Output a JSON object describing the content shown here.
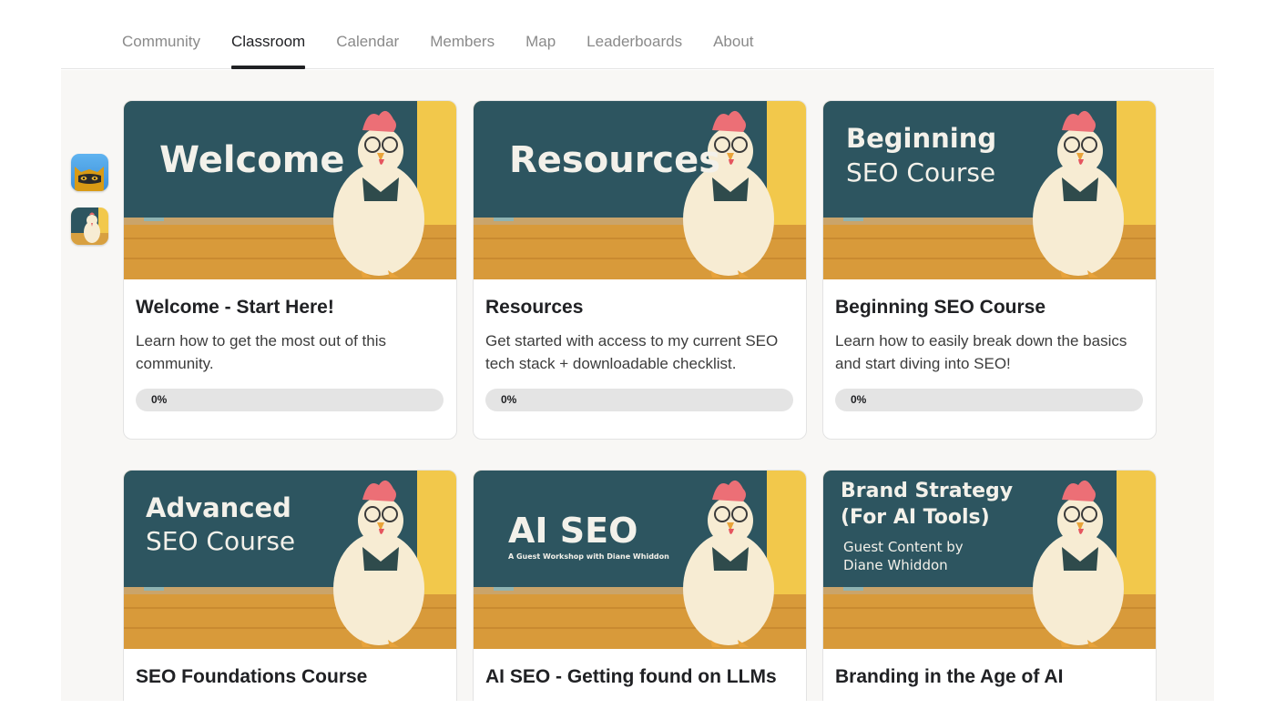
{
  "nav": {
    "tabs": [
      {
        "label": "Community"
      },
      {
        "label": "Classroom"
      },
      {
        "label": "Calendar"
      },
      {
        "label": "Members"
      },
      {
        "label": "Map"
      },
      {
        "label": "Leaderboards"
      },
      {
        "label": "About"
      }
    ],
    "active_tab": "Classroom"
  },
  "sidebar": {
    "icons": [
      "cat-icon",
      "chicken-icon"
    ]
  },
  "courses": [
    {
      "title": "Welcome - Start Here!",
      "description": "Learn how to get the most out of this community.",
      "progress_label": "0%",
      "progress": 0,
      "cover": {
        "line1": "Welcome",
        "line2": "",
        "sub1": "",
        "sub2": ""
      }
    },
    {
      "title": "Resources",
      "description": "Get started with access to my current SEO tech stack + downloadable checklist.",
      "progress_label": "0%",
      "progress": 0,
      "cover": {
        "line1": "Resources",
        "line2": "",
        "sub1": "",
        "sub2": ""
      }
    },
    {
      "title": "Beginning SEO Course",
      "description": "Learn how to easily break down the basics and start diving into SEO!",
      "progress_label": "0%",
      "progress": 0,
      "cover": {
        "line1": "Beginning",
        "line2": "SEO Course",
        "sub1": "",
        "sub2": ""
      }
    },
    {
      "title": "SEO Foundations Course",
      "description": "",
      "progress_label": "",
      "cover": {
        "line1": "Advanced",
        "line2": "SEO Course",
        "sub1": "",
        "sub2": ""
      }
    },
    {
      "title": "AI SEO - Getting found on LLMs",
      "description": "",
      "progress_label": "",
      "cover": {
        "line1": "AI SEO",
        "line2": "A Guest Workshop with Diane Whiddon",
        "sub1": "",
        "sub2": ""
      }
    },
    {
      "title": "Branding in the Age of AI",
      "description": "",
      "progress_label": "",
      "cover": {
        "line1": "Brand Strategy",
        "line2": "(For AI Tools)",
        "sub1": "Guest Content by",
        "sub2": "Diane Whiddon"
      }
    }
  ],
  "colors": {
    "chalkboard": "#2d5560",
    "wall": "#f2c84b",
    "accent": "#202124"
  }
}
